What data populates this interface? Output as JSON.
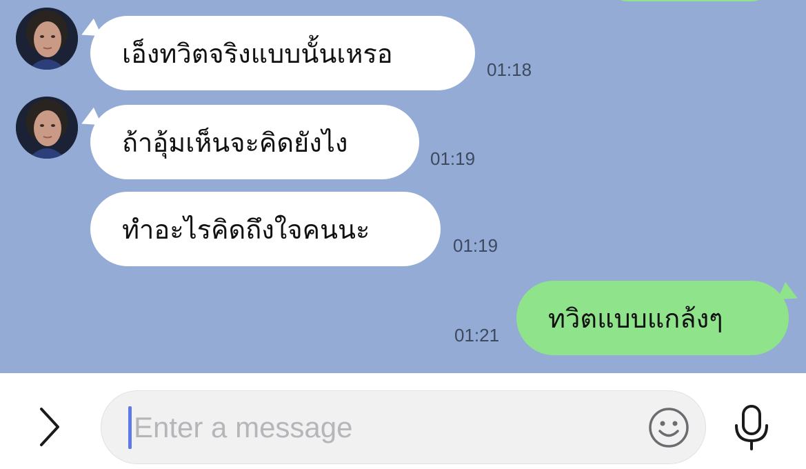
{
  "messages": [
    {
      "text": "เอ็งทวิตจริงแบบนั้นเหรอ",
      "time": "01:18",
      "side": "incoming"
    },
    {
      "text": "ถ้าอุ้มเห็นจะคิดยังไง",
      "time": "01:19",
      "side": "incoming"
    },
    {
      "text": "ทำอะไรคิดถึงใจคนนะ",
      "time": "01:19",
      "side": "incoming"
    },
    {
      "text": "ทวิตแบบแกล้งๆ",
      "time": "01:21",
      "side": "outgoing"
    }
  ],
  "composer": {
    "placeholder": "Enter a message"
  },
  "icons": {
    "expand": "chevron-right-icon",
    "emoji": "smiley-icon",
    "mic": "microphone-icon"
  },
  "colors": {
    "chat_background": "#93abd5",
    "incoming_bubble": "#ffffff",
    "outgoing_bubble": "#8fe38a",
    "caret": "#5f79e6"
  }
}
